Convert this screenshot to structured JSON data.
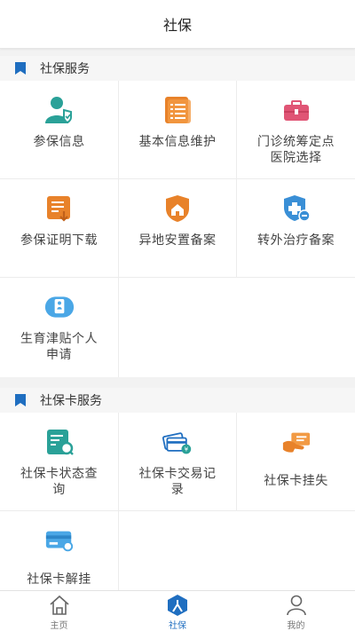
{
  "header": {
    "title": "社保"
  },
  "sections": [
    {
      "title": "社保服务",
      "items": [
        {
          "label": "参保信息",
          "icon": "user-shield-icon"
        },
        {
          "label": "基本信息维护",
          "icon": "document-list-icon"
        },
        {
          "label": "门诊统筹定点医院选择",
          "icon": "medical-kit-icon"
        },
        {
          "label": "参保证明下载",
          "icon": "certificate-download-icon"
        },
        {
          "label": "异地安置备案",
          "icon": "house-shield-icon"
        },
        {
          "label": "转外治疗备案",
          "icon": "medical-transfer-icon"
        },
        {
          "label": "生育津贴个人申请",
          "icon": "maternity-icon"
        }
      ]
    },
    {
      "title": "社保卡服务",
      "items": [
        {
          "label": "社保卡状态查询",
          "icon": "card-search-icon"
        },
        {
          "label": "社保卡交易记录",
          "icon": "card-transaction-icon"
        },
        {
          "label": "社保卡挂失",
          "icon": "card-report-loss-icon"
        },
        {
          "label": "社保卡解挂",
          "icon": "card-unlock-icon"
        }
      ]
    }
  ],
  "tabs": [
    {
      "label": "主页",
      "icon": "home-icon"
    },
    {
      "label": "社保",
      "icon": "social-security-icon",
      "active": true
    },
    {
      "label": "我的",
      "icon": "profile-icon"
    }
  ],
  "colors": {
    "accent": "#1f6ec0",
    "teal": "#2aa198",
    "orange": "#e8822a",
    "pink": "#e05575",
    "blue": "#3a8fd6"
  }
}
